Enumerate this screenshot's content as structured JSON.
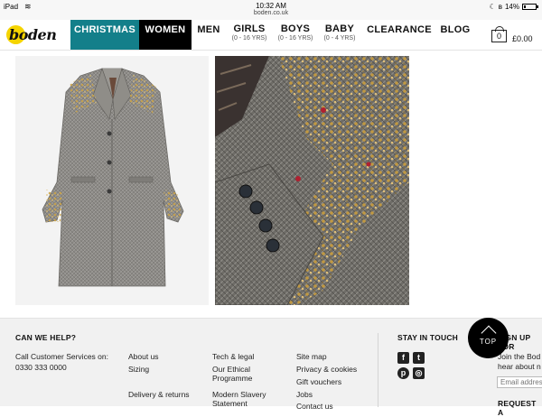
{
  "status_bar": {
    "device": "iPad",
    "time": "10:32 AM",
    "url": "boden.co.uk",
    "battery": "14%",
    "battery_level": 0.14
  },
  "nav": {
    "logo": "boden",
    "items": [
      {
        "label": "CHRISTMAS",
        "sub": ""
      },
      {
        "label": "WOMEN",
        "sub": ""
      },
      {
        "label": "MEN",
        "sub": ""
      },
      {
        "label": "GIRLS",
        "sub": "(0 - 16 YRS)"
      },
      {
        "label": "BOYS",
        "sub": "(0 - 16 YRS)"
      },
      {
        "label": "BABY",
        "sub": "(0 - 4 YRS)"
      },
      {
        "label": "CLEARANCE",
        "sub": ""
      },
      {
        "label": "BLOG",
        "sub": ""
      }
    ],
    "bag_count": "0",
    "bag_total": "£0.00"
  },
  "colors": {
    "christmas_tab": "#137f8a",
    "women_tab": "#000000",
    "logo_yellow": "#f5d400",
    "footer_bg": "#f1f1f1"
  },
  "footer": {
    "help_heading": "CAN WE HELP?",
    "call_label": "Call Customer Services on:",
    "phone": "0330 333 0000",
    "links_col1": [
      "About us",
      "Sizing",
      "Delivery & returns"
    ],
    "links_col2": [
      "Tech & legal",
      "Our Ethical Programme",
      "Modern Slavery Statement"
    ],
    "links_col3": [
      "Site map",
      "Privacy & cookies",
      "Gift vouchers",
      "Jobs",
      "Contact us"
    ],
    "stay_heading": "STAY IN TOUCH",
    "social": [
      "facebook-icon",
      "twitter-icon",
      "pinterest-icon",
      "instagram-icon"
    ],
    "signup_heading": "SIGN UP FOR",
    "signup_text_1": "Join the Bod",
    "signup_text_2": "hear about n",
    "email_placeholder": "Email addres",
    "request_heading": "REQUEST A"
  },
  "top_button": "TOP"
}
